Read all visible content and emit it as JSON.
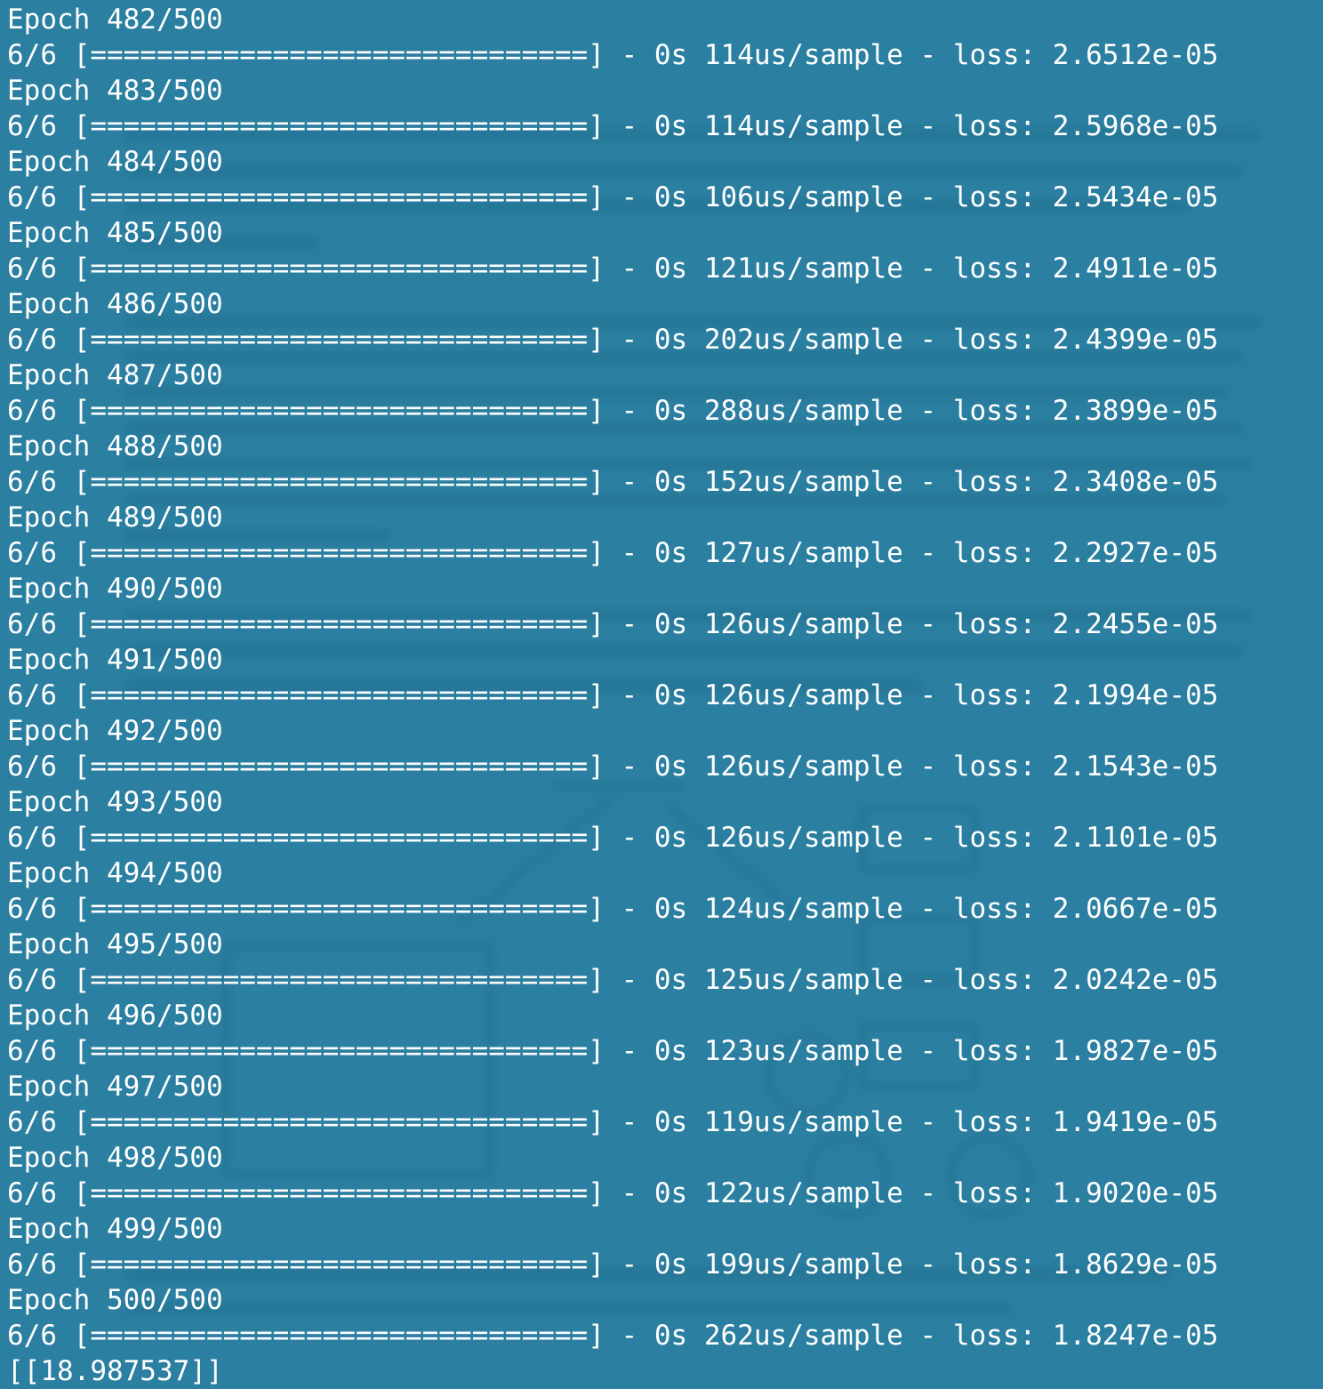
{
  "terminal": {
    "lines": [
      "Epoch 482/500",
      "6/6 [==============================] - 0s 114us/sample - loss: 2.6512e-05",
      "Epoch 483/500",
      "6/6 [==============================] - 0s 114us/sample - loss: 2.5968e-05",
      "Epoch 484/500",
      "6/6 [==============================] - 0s 106us/sample - loss: 2.5434e-05",
      "Epoch 485/500",
      "6/6 [==============================] - 0s 121us/sample - loss: 2.4911e-05",
      "Epoch 486/500",
      "6/6 [==============================] - 0s 202us/sample - loss: 2.4399e-05",
      "Epoch 487/500",
      "6/6 [==============================] - 0s 288us/sample - loss: 2.3899e-05",
      "Epoch 488/500",
      "6/6 [==============================] - 0s 152us/sample - loss: 2.3408e-05",
      "Epoch 489/500",
      "6/6 [==============================] - 0s 127us/sample - loss: 2.2927e-05",
      "Epoch 490/500",
      "6/6 [==============================] - 0s 126us/sample - loss: 2.2455e-05",
      "Epoch 491/500",
      "6/6 [==============================] - 0s 126us/sample - loss: 2.1994e-05",
      "Epoch 492/500",
      "6/6 [==============================] - 0s 126us/sample - loss: 2.1543e-05",
      "Epoch 493/500",
      "6/6 [==============================] - 0s 126us/sample - loss: 2.1101e-05",
      "Epoch 494/500",
      "6/6 [==============================] - 0s 124us/sample - loss: 2.0667e-05",
      "Epoch 495/500",
      "6/6 [==============================] - 0s 125us/sample - loss: 2.0242e-05",
      "Epoch 496/500",
      "6/6 [==============================] - 0s 123us/sample - loss: 1.9827e-05",
      "Epoch 497/500",
      "6/6 [==============================] - 0s 119us/sample - loss: 1.9419e-05",
      "Epoch 498/500",
      "6/6 [==============================] - 0s 122us/sample - loss: 1.9020e-05",
      "Epoch 499/500",
      "6/6 [==============================] - 0s 199us/sample - loss: 1.8629e-05",
      "Epoch 500/500",
      "6/6 [==============================] - 0s 262us/sample - loss: 1.8247e-05",
      "[[18.987537]]"
    ]
  },
  "colors": {
    "background": "#2b7fa0",
    "text": "#ffffff"
  }
}
